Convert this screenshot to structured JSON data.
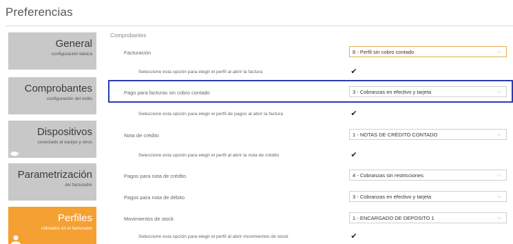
{
  "page": {
    "title": "Preferencias"
  },
  "nav": {
    "items": [
      {
        "label": "General",
        "sub": "configuración básica",
        "active": false
      },
      {
        "label": "Comprobantes",
        "sub": "configuración del estilo",
        "active": false
      },
      {
        "label": "Dispositivos",
        "sub": "conectado al equipo y otros",
        "active": false
      },
      {
        "label": "Parametrización",
        "sub": "del facturador",
        "active": false
      },
      {
        "label": "Perfiles",
        "sub": "utilizados en el facturador",
        "active": true
      }
    ]
  },
  "section": {
    "label": "Comprobantes"
  },
  "rows": [
    {
      "label": "Facturación",
      "value": "8 - Perfil sin cobro contado"
    },
    {
      "label": "Seleccione esta opción para elegir el perfil al abrir la factura",
      "checked": true
    },
    {
      "label": "Pago para facturas sin cobro contado",
      "value": "3 - Cobranzas en efectivo y tarjeta"
    },
    {
      "label": "Seleccione esta opción para elegir el perfil de pagos al abrir la factura",
      "checked": true
    },
    {
      "label": "Nota de crédito",
      "value": "1 - NOTAS DE CRÉDITO CONTADO"
    },
    {
      "label": "Seleccione esta opción para elegir el perfil al abrir la nota de crédito",
      "checked": true
    },
    {
      "label": "Pagos para nota de crédito",
      "value": "4 - Cobranzas sin restricciones"
    },
    {
      "label": "Pagos para nota de débito",
      "value": "3 - Cobranzas en efectivo y tarjeta"
    },
    {
      "label": "Movimientos de stock",
      "value": "1 - ENCARGADO DE DEPOSITO 1"
    },
    {
      "label": "Seleccione esta opción para elegir el perfil al abrir movimientos de stock",
      "checked": true
    }
  ],
  "icons": {
    "select_chevron": "chevron-down-icon",
    "checkbox": "checkmark-icon",
    "plug": "plug-icon",
    "user": "user-icon"
  },
  "colors": {
    "active_nav": "#f5a032",
    "inactive_nav": "#c8c8c8",
    "highlight": "#2b3bb0",
    "focus_border": "#e6a94a"
  },
  "glyphs": {
    "chevron": "⌵",
    "check": "✔"
  }
}
